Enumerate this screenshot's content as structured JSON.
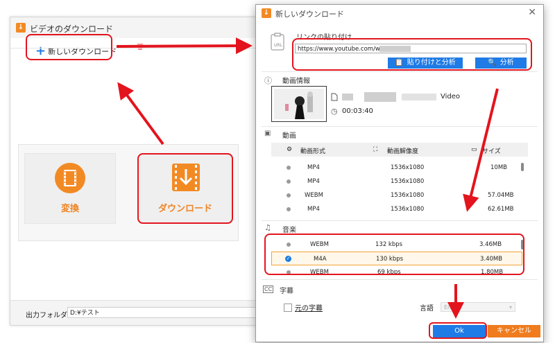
{
  "colors": {
    "accent_orange": "#f08424",
    "accent_blue": "#1f7be6",
    "highlight_red": "#e3141d"
  },
  "main_window": {
    "title": "ビデオのダウンロード",
    "new_download_label": "新しいダウンロード",
    "cards": [
      {
        "label": "変換",
        "icon": "film-convert-icon"
      },
      {
        "label": "ダウンロード",
        "icon": "download-arrow-icon"
      }
    ],
    "output_folder_label": "出力フォルダ：",
    "output_folder_value": "D:¥テスト"
  },
  "dialog": {
    "title": "新しいダウンロード",
    "paste_link_label": "リンクの貼り付け",
    "url_value": "https://www.youtube.com/watch?v=",
    "paste_analyze_button": "貼り付けと分析",
    "analyze_button": "分析",
    "video_info_label": "動画情報",
    "video_title_suffix": "Video",
    "duration": "00:03:40",
    "video_section_label": "動画",
    "columns": {
      "format": "動画形式",
      "resolution": "動画解像度",
      "size": "サイズ"
    },
    "video_rows": [
      {
        "format": "MP4",
        "resolution": "1536x1080",
        "size": "10MB"
      },
      {
        "format": "MP4",
        "resolution": "1536x1080",
        "size": ""
      },
      {
        "format": "WEBM",
        "resolution": "1536x1080",
        "size": "57.04MB"
      },
      {
        "format": "MP4",
        "resolution": "1536x1080",
        "size": "62.61MB"
      }
    ],
    "audio_section_label": "音楽",
    "audio_rows": [
      {
        "format": "WEBM",
        "bitrate": "132 kbps",
        "size": "3.46MB"
      },
      {
        "format": "M4A",
        "bitrate": "130 kbps",
        "size": "3.40MB"
      },
      {
        "format": "WEBM",
        "bitrate": "69 kbps",
        "size": "1.80MB"
      }
    ],
    "subtitle_section_label": "字幕",
    "original_subtitle_label": "元の字幕",
    "language_label": "言語",
    "language_value": "En",
    "ok_button": "Ok",
    "cancel_button": "キャンセル"
  }
}
